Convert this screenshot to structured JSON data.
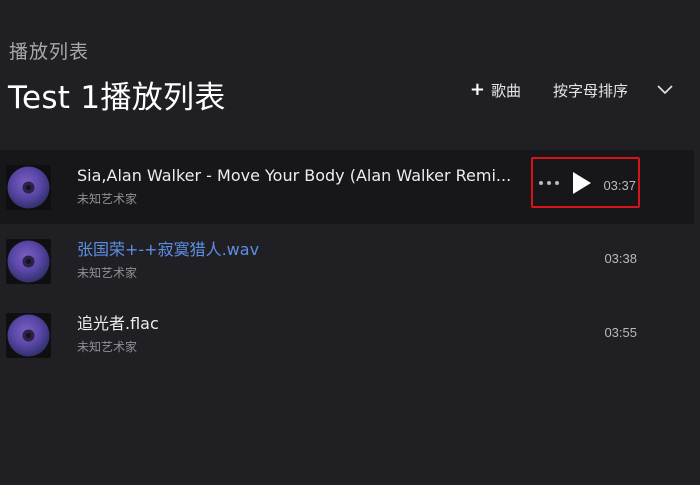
{
  "header": {
    "section_label": "播放列表",
    "playlist_title": "Test 1播放列表"
  },
  "toolbar": {
    "add_song_label": "歌曲",
    "add_icon": "plus-icon",
    "sort_label": "按字母排序",
    "dropdown_icon": "chevron-down-icon"
  },
  "songs": [
    {
      "title": "Sia,Alan Walker - Move Your Body (Alan Walker Remi...",
      "artist": "未知艺术家",
      "duration": "03:37",
      "selected": true,
      "highlight": false
    },
    {
      "title": "张国荣+-+寂寞猎人.wav",
      "artist": "未知艺术家",
      "duration": "03:38",
      "selected": false,
      "highlight": true
    },
    {
      "title": "追光者.flac",
      "artist": "未知艺术家",
      "duration": "03:55",
      "selected": false,
      "highlight": false
    }
  ],
  "colors": {
    "background": "#202024",
    "selected_row": "#17171a",
    "highlight_text": "#5c8fe3",
    "annotation_border": "#d5141b"
  }
}
